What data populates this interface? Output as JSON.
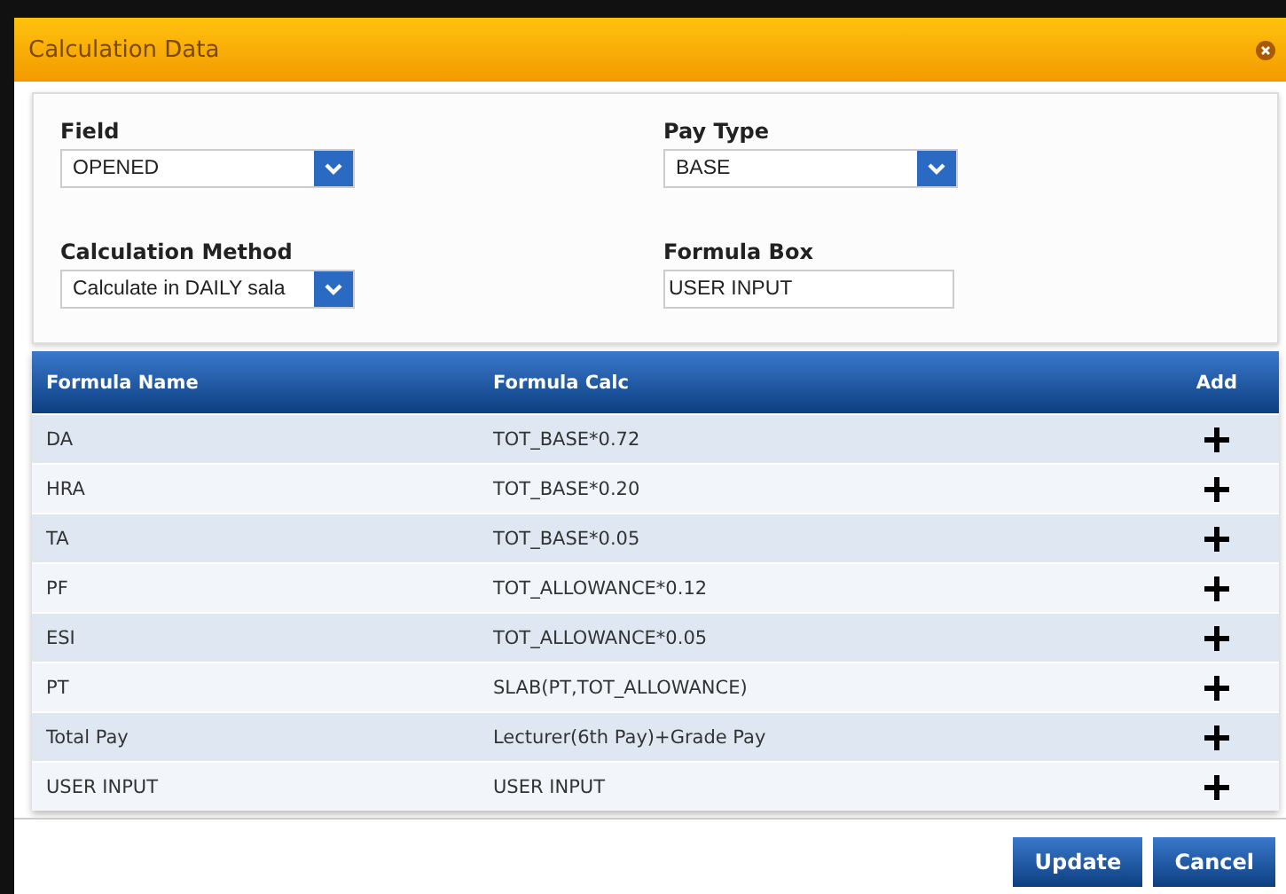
{
  "window": {
    "title": "Calculation Data"
  },
  "form": {
    "fields": [
      {
        "label": "Field",
        "kind": "select",
        "value": "OPENED"
      },
      {
        "label": "Pay Type",
        "kind": "select",
        "value": "BASE"
      },
      {
        "label": "Calculation Method",
        "kind": "select",
        "value": "Calculate in DAILY sala"
      },
      {
        "label": "Formula Box",
        "kind": "text",
        "value": "USER INPUT"
      }
    ]
  },
  "table": {
    "columns": [
      "Formula Name",
      "Formula Calc",
      "Add"
    ],
    "rows": [
      {
        "name": "DA",
        "calc": "TOT_BASE*0.72"
      },
      {
        "name": "HRA",
        "calc": "TOT_BASE*0.20"
      },
      {
        "name": "TA",
        "calc": "TOT_BASE*0.05"
      },
      {
        "name": "PF",
        "calc": "TOT_ALLOWANCE*0.12"
      },
      {
        "name": "ESI",
        "calc": "TOT_ALLOWANCE*0.05"
      },
      {
        "name": "PT",
        "calc": "SLAB(PT,TOT_ALLOWANCE)"
      },
      {
        "name": "Total Pay",
        "calc": "Lecturer(6th Pay)+Grade Pay"
      },
      {
        "name": "USER INPUT",
        "calc": "USER INPUT"
      }
    ]
  },
  "buttons": [
    "Update",
    "Cancel"
  ]
}
